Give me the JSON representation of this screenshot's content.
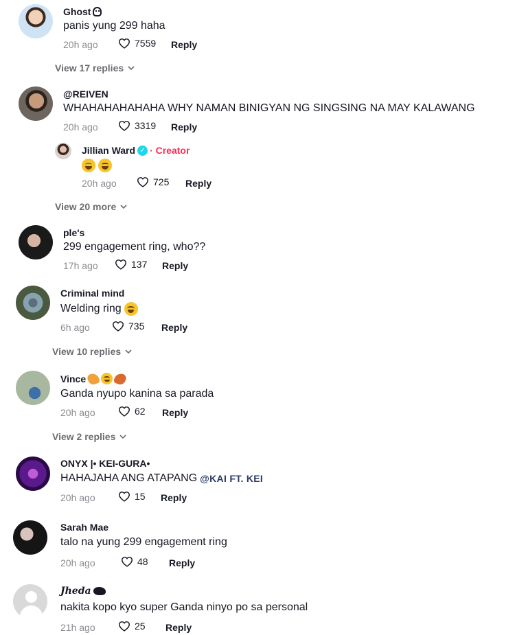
{
  "comments": [
    {
      "name": "Ghost",
      "text": "panis yung 299 haha",
      "time": "20h ago",
      "likes": "7559",
      "reply": "Reply",
      "view": "View 17 replies"
    },
    {
      "name": "@REIVEN",
      "text": "WHAHAHAHAHAHA WHY NAMAN BINIGYAN NG SINGSING NA MAY KALAWANG",
      "time": "20h ago",
      "likes": "3319",
      "reply": "Reply",
      "subreply": {
        "name": "Jillian Ward",
        "badge": "· Creator",
        "time": "20h ago",
        "likes": "725",
        "reply": "Reply"
      },
      "view": "View 20 more"
    },
    {
      "name": "ple's",
      "text": "299 engagement ring, who??",
      "time": "17h ago",
      "likes": "137",
      "reply": "Reply"
    },
    {
      "name": "Criminal mind",
      "text": "Welding ring",
      "time": "6h ago",
      "likes": "735",
      "reply": "Reply",
      "view": "View 10 replies"
    },
    {
      "name": "Vince",
      "text": "Ganda nyupo kanina sa parada",
      "time": "20h ago",
      "likes": "62",
      "reply": "Reply",
      "view": "View 2 replies"
    },
    {
      "name": "ONYX |• KEI-GURA•",
      "text": "HAHAJAHA ANG ATAPANG",
      "mention": "@KAI FT. KEI",
      "time": "20h ago",
      "likes": "15",
      "reply": "Reply"
    },
    {
      "name": "Sarah Mae",
      "text": "talo na yung 299 engagement ring",
      "time": "20h ago",
      "likes": "48",
      "reply": "Reply"
    },
    {
      "name": "Jheda",
      "text": "nakita kopo kyo super Ganda ninyo po sa personal",
      "time": "21h ago",
      "likes": "25",
      "reply": "Reply"
    }
  ],
  "colors": {
    "accent": "#fe2c55",
    "verified": "#20d5ec",
    "muted": "#8a8b91"
  }
}
